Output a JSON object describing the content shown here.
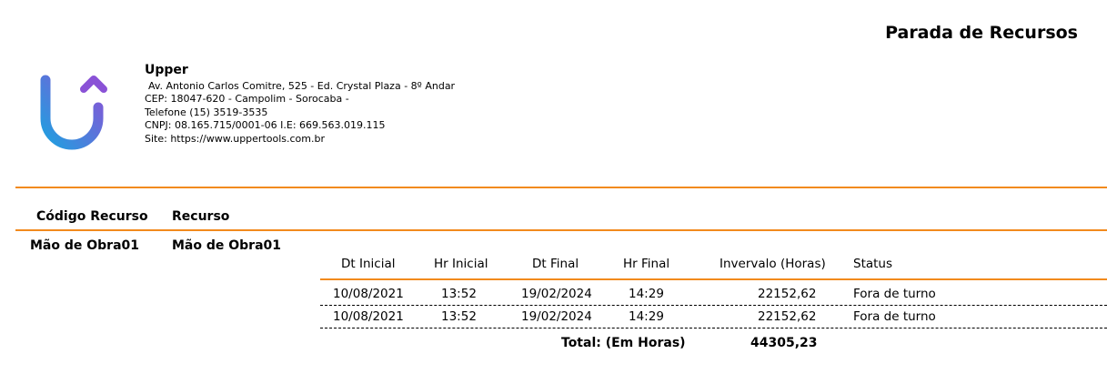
{
  "report": {
    "title": "Parada de Recursos"
  },
  "company": {
    "name": "Upper",
    "address": "Av. Antonio Carlos Comitre, 525 - Ed. Crystal Plaza - 8º Andar",
    "cep": "CEP: 18047-620 - Campolim - Sorocaba -",
    "phone": "Telefone  (15) 3519-3535",
    "cnpj_ie": "CNPJ: 08.165.715/0001-06     I.E:  669.563.019.115",
    "site": "Site: https://www.uppertools.com.br",
    "logo_colors": {
      "start": "#1fa0e0",
      "end": "#8a52d6"
    }
  },
  "header": {
    "code_label": "Código Recurso",
    "resource_label": "Recurso"
  },
  "group": {
    "code": "Mão de Obra01",
    "resource": "Mão de Obra01"
  },
  "table": {
    "columns": [
      "Dt Inicial",
      "Hr Inicial",
      "Dt Final",
      "Hr Final",
      "Invervalo (Horas)",
      "Status"
    ],
    "rows": [
      [
        "10/08/2021",
        "13:52",
        "19/02/2024",
        "14:29",
        "22152,62",
        "Fora de turno"
      ],
      [
        "10/08/2021",
        "13:52",
        "19/02/2024",
        "14:29",
        "22152,62",
        "Fora de turno"
      ]
    ]
  },
  "total": {
    "label": "Total: (Em Horas)",
    "value": "44305,23"
  },
  "accent_color": "#f28a1d"
}
